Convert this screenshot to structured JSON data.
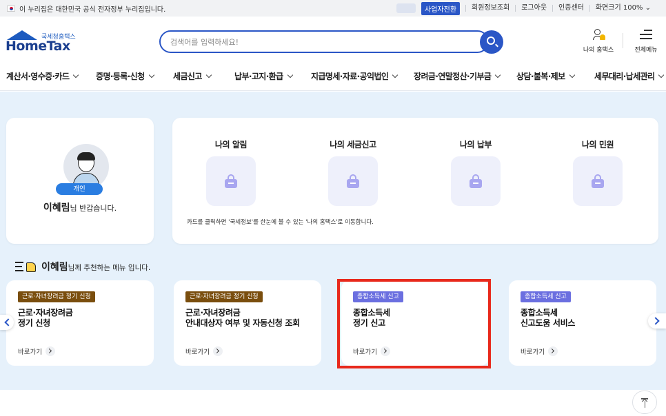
{
  "gov_bar": {
    "text": "이 누리집은 대한민국 공식 전자정부 누리집입니다.",
    "business_switch": "사업자전환",
    "links": [
      "회원정보조회",
      "로그아웃",
      "인증센터",
      "화면크기 100%"
    ]
  },
  "header": {
    "logo_sub": "국세청홈택스",
    "logo_main": "HomeTax",
    "search_placeholder": "검색어를 입력하세요!",
    "my_hometax": "나의 홈택스",
    "all_menu": "전체메뉴"
  },
  "nav": [
    {
      "label": "계산서·영수증·카드"
    },
    {
      "label": "증명·등록·신청"
    },
    {
      "label": "세금신고"
    },
    {
      "label": "납부·고지·환급"
    },
    {
      "label": "지급명세·자료·공익법인"
    },
    {
      "label": "장려금·연말정산·기부금"
    },
    {
      "label": "상담·불복·제보"
    },
    {
      "label": "세무대리·납세관리"
    }
  ],
  "profile": {
    "badge": "개인",
    "name": "이혜림",
    "greeting": "님 반갑습니다."
  },
  "my_section": {
    "columns": [
      {
        "title": "나의 알림"
      },
      {
        "title": "나의 세금신고"
      },
      {
        "title": "나의 납부"
      },
      {
        "title": "나의 민원"
      }
    ],
    "note": "카드를 클릭하면 '국세정보'를 한눈에 볼 수 있는 '나의 홈택스'로 이동합니다."
  },
  "recommend": {
    "name": "이혜림",
    "rest": "님께 추천하는 메뉴 입니다.",
    "cards": [
      {
        "tag": "근로·자녀장려금 정기 신청",
        "title1": "근로·자녀장려금",
        "title2": "정기 신청",
        "link": "바로가기"
      },
      {
        "tag": "근로·자녀장려금 정기 신청",
        "title1": "근로·자녀장려금",
        "title2": "안내대상자 여부 및 자동신청 조회",
        "link": "바로가기"
      },
      {
        "tag": "종합소득세 신고",
        "title1": "종합소득세",
        "title2": "정기 신고",
        "link": "바로가기"
      },
      {
        "tag": "종합소득세 신고",
        "title1": "종합소득세",
        "title2": "신고도움 서비스",
        "link": "바로가기"
      }
    ]
  },
  "colors": {
    "brand_blue": "#2a56c6",
    "tag_brown": "#7a4e0e",
    "tag_purple": "#6b6fe0",
    "highlight_red": "#e8291c",
    "band_bg": "#e6f1fb"
  }
}
